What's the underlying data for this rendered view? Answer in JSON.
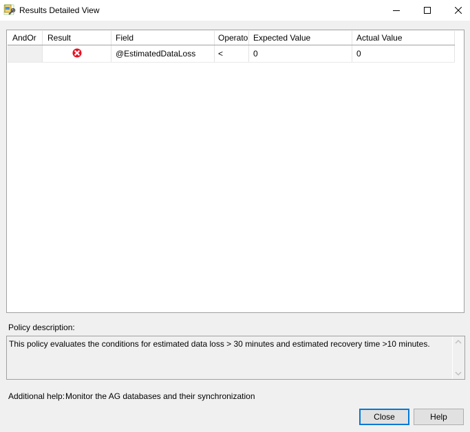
{
  "window": {
    "title": "Results Detailed View",
    "app_icon": "policy-tool-icon",
    "controls": {
      "minimize_icon": "minimize-icon",
      "maximize_icon": "maximize-icon",
      "close_icon": "close-icon"
    }
  },
  "grid": {
    "columns": [
      "AndOr",
      "Result",
      "Field",
      "Operator",
      "Expected Value",
      "Actual Value"
    ],
    "rows": [
      {
        "andor": "",
        "result_icon": "error-icon",
        "result_status": "failed",
        "field": "@EstimatedDataLoss",
        "operator": "<",
        "expected_value": "0",
        "actual_value": "0"
      }
    ]
  },
  "policy_description": {
    "label": "Policy description:",
    "text": "This policy evaluates the conditions for estimated data loss > 30 minutes and estimated recovery time >10 minutes."
  },
  "additional_help": {
    "label": "Additional help:",
    "text": "Monitor the AG databases and their synchronization"
  },
  "buttons": {
    "close_label": "Close",
    "help_label": "Help"
  },
  "colors": {
    "error_red": "#e81123",
    "focus_blue": "#0078d7"
  }
}
